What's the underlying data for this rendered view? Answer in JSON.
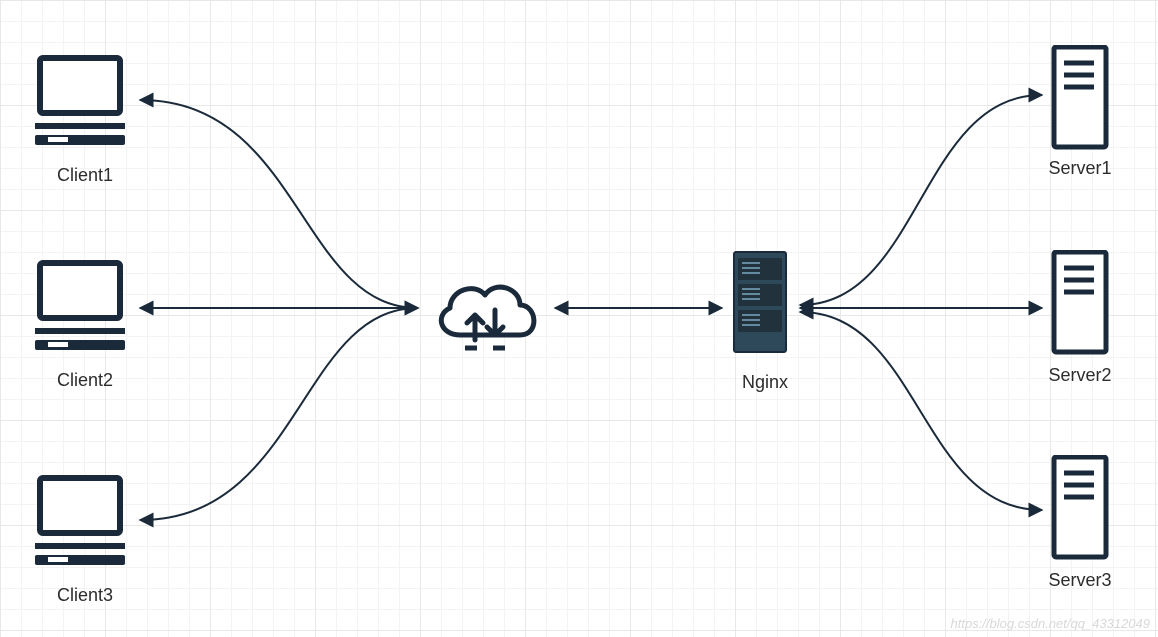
{
  "diagram": {
    "clients": [
      "Client1",
      "Client2",
      "Client3"
    ],
    "servers": [
      "Server1",
      "Server2",
      "Server3"
    ],
    "center_cloud_label": "",
    "proxy_label": "Nginx"
  },
  "colors": {
    "stroke": "#1a2a3a",
    "server_fill": "#2e4a5a",
    "server_dark": "#22323c"
  },
  "watermark": "https://blog.csdn.net/qq_43312049"
}
